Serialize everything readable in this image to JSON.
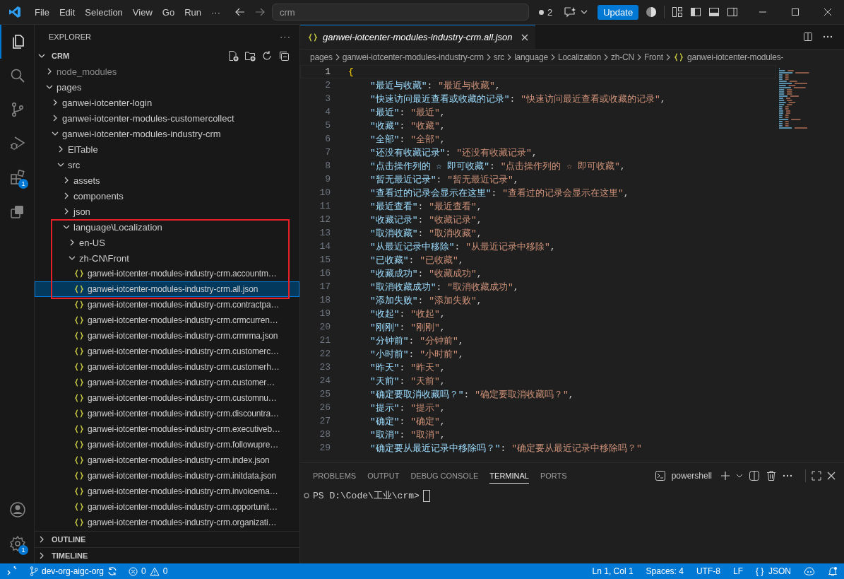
{
  "window": {
    "menu": [
      "File",
      "Edit",
      "Selection",
      "View",
      "Go",
      "Run",
      "···"
    ],
    "search": {
      "value": "crm"
    },
    "pending_count": "2",
    "update_button": "Update"
  },
  "activity_bar": {
    "items": [
      {
        "kind": "explorer",
        "selected": true
      },
      {
        "kind": "search",
        "selected": false
      },
      {
        "kind": "source-control",
        "selected": false
      },
      {
        "kind": "run-debug",
        "selected": false
      },
      {
        "kind": "extensions",
        "selected": false,
        "badge": "1"
      },
      {
        "kind": "remote",
        "selected": false
      }
    ],
    "bottom": [
      {
        "kind": "account"
      },
      {
        "kind": "settings",
        "badge": "1"
      }
    ]
  },
  "sidebar": {
    "title": "EXPLORER",
    "more": "···",
    "folder": "CRM",
    "tree": [
      {
        "kind": "folder",
        "label": "node_modules",
        "expanded": false,
        "ignored": true,
        "selected": false,
        "boxed": false
      },
      {
        "kind": "folder",
        "label": "pages",
        "expanded": true,
        "ignored": false,
        "selected": false,
        "boxed": false,
        "children": [
          {
            "kind": "folder",
            "label": "ganwei-iotcenter-login",
            "expanded": false,
            "ignored": false,
            "selected": false,
            "boxed": false
          },
          {
            "kind": "folder",
            "label": "ganwei-iotcenter-modules-customercollect",
            "expanded": false,
            "ignored": false,
            "selected": false,
            "boxed": false
          },
          {
            "kind": "folder",
            "label": "ganwei-iotcenter-modules-industry-crm",
            "expanded": true,
            "ignored": false,
            "selected": false,
            "boxed": false,
            "children": [
              {
                "kind": "folder",
                "label": "ElTable",
                "expanded": false,
                "ignored": false,
                "selected": false,
                "boxed": false
              },
              {
                "kind": "folder",
                "label": "src",
                "expanded": true,
                "ignored": false,
                "selected": false,
                "boxed": false,
                "children": [
                  {
                    "kind": "folder",
                    "label": "assets",
                    "expanded": false,
                    "ignored": false,
                    "selected": false,
                    "boxed": false
                  },
                  {
                    "kind": "folder",
                    "label": "components",
                    "expanded": false,
                    "ignored": false,
                    "selected": false,
                    "boxed": false
                  },
                  {
                    "kind": "folder",
                    "label": "json",
                    "expanded": false,
                    "ignored": false,
                    "selected": false,
                    "boxed": false
                  },
                  {
                    "kind": "folder",
                    "label": "language\\Localization",
                    "expanded": true,
                    "ignored": false,
                    "selected": false,
                    "boxed": true,
                    "children": [
                      {
                        "kind": "folder",
                        "label": "en-US",
                        "expanded": false,
                        "ignored": false,
                        "selected": false,
                        "boxed": true
                      },
                      {
                        "kind": "folder",
                        "label": "zh-CN\\Front",
                        "expanded": true,
                        "ignored": false,
                        "selected": false,
                        "boxed": true,
                        "children": [
                          {
                            "kind": "file",
                            "label": "ganwei-iotcenter-modules-industry-crm.accountm…",
                            "selected": false,
                            "boxed": true
                          },
                          {
                            "kind": "file",
                            "label": "ganwei-iotcenter-modules-industry-crm.all.json",
                            "selected": true,
                            "boxed": true
                          },
                          {
                            "kind": "file",
                            "label": "ganwei-iotcenter-modules-industry-crm.contractpa…",
                            "selected": false,
                            "boxed": false
                          },
                          {
                            "kind": "file",
                            "label": "ganwei-iotcenter-modules-industry-crm.crmcurren…",
                            "selected": false,
                            "boxed": false
                          },
                          {
                            "kind": "file",
                            "label": "ganwei-iotcenter-modules-industry-crm.crmrma.json",
                            "selected": false,
                            "boxed": false
                          },
                          {
                            "kind": "file",
                            "label": "ganwei-iotcenter-modules-industry-crm.customerc…",
                            "selected": false,
                            "boxed": false
                          },
                          {
                            "kind": "file",
                            "label": "ganwei-iotcenter-modules-industry-crm.customerh…",
                            "selected": false,
                            "boxed": false
                          },
                          {
                            "kind": "file",
                            "label": "ganwei-iotcenter-modules-industry-crm.customer…",
                            "selected": false,
                            "boxed": false
                          },
                          {
                            "kind": "file",
                            "label": "ganwei-iotcenter-modules-industry-crm.customnu…",
                            "selected": false,
                            "boxed": false
                          },
                          {
                            "kind": "file",
                            "label": "ganwei-iotcenter-modules-industry-crm.discountra…",
                            "selected": false,
                            "boxed": false
                          },
                          {
                            "kind": "file",
                            "label": "ganwei-iotcenter-modules-industry-crm.executiveb…",
                            "selected": false,
                            "boxed": false
                          },
                          {
                            "kind": "file",
                            "label": "ganwei-iotcenter-modules-industry-crm.followupre…",
                            "selected": false,
                            "boxed": false
                          },
                          {
                            "kind": "file",
                            "label": "ganwei-iotcenter-modules-industry-crm.index.json",
                            "selected": false,
                            "boxed": false
                          },
                          {
                            "kind": "file",
                            "label": "ganwei-iotcenter-modules-industry-crm.initdata.json",
                            "selected": false,
                            "boxed": false
                          },
                          {
                            "kind": "file",
                            "label": "ganwei-iotcenter-modules-industry-crm.invoicema…",
                            "selected": false,
                            "boxed": false
                          },
                          {
                            "kind": "file",
                            "label": "ganwei-iotcenter-modules-industry-crm.opportunit…",
                            "selected": false,
                            "boxed": false
                          },
                          {
                            "kind": "file",
                            "label": "ganwei-iotcenter-modules-industry-crm.organizati…",
                            "selected": false,
                            "boxed": false
                          }
                        ]
                      }
                    ]
                  }
                ]
              }
            ]
          }
        ]
      }
    ],
    "sections": [
      {
        "label": "OUTLINE",
        "expanded": false
      },
      {
        "label": "TIMELINE",
        "expanded": false
      }
    ]
  },
  "editor": {
    "tab": {
      "title": "ganwei-iotcenter-modules-industry-crm.all.json",
      "selected": true
    },
    "breadcrumbs": [
      "pages",
      "ganwei-iotcenter-modules-industry-crm",
      "src",
      "language",
      "Localization",
      "zh-CN",
      "Front",
      "ganwei-iotcenter-modules-"
    ],
    "lines": [
      {
        "n": "1",
        "current": true,
        "kind": "brace",
        "tokens": [
          "{"
        ]
      },
      {
        "n": "2",
        "current": false,
        "kind": "pair",
        "tokens": [
          "\"最近与收藏\"",
          ": ",
          "\"最近与收藏\"",
          ","
        ]
      },
      {
        "n": "3",
        "current": false,
        "kind": "pair",
        "tokens": [
          "\"快速访问最近查看或收藏的记录\"",
          ": ",
          "\"快速访问最近查看或收藏的记录\"",
          ","
        ]
      },
      {
        "n": "4",
        "current": false,
        "kind": "pair",
        "tokens": [
          "\"最近\"",
          ": ",
          "\"最近\"",
          ","
        ]
      },
      {
        "n": "5",
        "current": false,
        "kind": "pair",
        "tokens": [
          "\"收藏\"",
          ": ",
          "\"收藏\"",
          ","
        ]
      },
      {
        "n": "6",
        "current": false,
        "kind": "pair",
        "tokens": [
          "\"全部\"",
          ": ",
          "\"全部\"",
          ","
        ]
      },
      {
        "n": "7",
        "current": false,
        "kind": "pair",
        "tokens": [
          "\"还没有收藏记录\"",
          ": ",
          "\"还没有收藏记录\"",
          ","
        ]
      },
      {
        "n": "8",
        "current": false,
        "kind": "pair",
        "tokens": [
          "\"点击操作列的 ☆ 即可收藏\"",
          ": ",
          "\"点击操作列的 ☆ 即可收藏\"",
          ","
        ]
      },
      {
        "n": "9",
        "current": false,
        "kind": "pair",
        "tokens": [
          "\"暂无最近记录\"",
          ": ",
          "\"暂无最近记录\"",
          ","
        ]
      },
      {
        "n": "10",
        "current": false,
        "kind": "pair",
        "tokens": [
          "\"查看过的记录会显示在这里\"",
          ": ",
          "\"查看过的记录会显示在这里\"",
          ","
        ]
      },
      {
        "n": "11",
        "current": false,
        "kind": "pair",
        "tokens": [
          "\"最近查看\"",
          ": ",
          "\"最近查看\"",
          ","
        ]
      },
      {
        "n": "12",
        "current": false,
        "kind": "pair",
        "tokens": [
          "\"收藏记录\"",
          ": ",
          "\"收藏记录\"",
          ","
        ]
      },
      {
        "n": "13",
        "current": false,
        "kind": "pair",
        "tokens": [
          "\"取消收藏\"",
          ": ",
          "\"取消收藏\"",
          ","
        ]
      },
      {
        "n": "14",
        "current": false,
        "kind": "pair",
        "tokens": [
          "\"从最近记录中移除\"",
          ": ",
          "\"从最近记录中移除\"",
          ","
        ]
      },
      {
        "n": "15",
        "current": false,
        "kind": "pair",
        "tokens": [
          "\"已收藏\"",
          ": ",
          "\"已收藏\"",
          ","
        ]
      },
      {
        "n": "16",
        "current": false,
        "kind": "pair",
        "tokens": [
          "\"收藏成功\"",
          ": ",
          "\"收藏成功\"",
          ","
        ]
      },
      {
        "n": "17",
        "current": false,
        "kind": "pair",
        "tokens": [
          "\"取消收藏成功\"",
          ": ",
          "\"取消收藏成功\"",
          ","
        ]
      },
      {
        "n": "18",
        "current": false,
        "kind": "pair",
        "tokens": [
          "\"添加失败\"",
          ": ",
          "\"添加失败\"",
          ","
        ]
      },
      {
        "n": "19",
        "current": false,
        "kind": "pair",
        "tokens": [
          "\"收起\"",
          ": ",
          "\"收起\"",
          ","
        ]
      },
      {
        "n": "20",
        "current": false,
        "kind": "pair",
        "tokens": [
          "\"刚刚\"",
          ": ",
          "\"刚刚\"",
          ","
        ]
      },
      {
        "n": "21",
        "current": false,
        "kind": "pair",
        "tokens": [
          "\"分钟前\"",
          ": ",
          "\"分钟前\"",
          ","
        ]
      },
      {
        "n": "22",
        "current": false,
        "kind": "pair",
        "tokens": [
          "\"小时前\"",
          ": ",
          "\"小时前\"",
          ","
        ]
      },
      {
        "n": "23",
        "current": false,
        "kind": "pair",
        "tokens": [
          "\"昨天\"",
          ": ",
          "\"昨天\"",
          ","
        ]
      },
      {
        "n": "24",
        "current": false,
        "kind": "pair",
        "tokens": [
          "\"天前\"",
          ": ",
          "\"天前\"",
          ","
        ]
      },
      {
        "n": "25",
        "current": false,
        "kind": "pair",
        "tokens": [
          "\"确定要取消收藏吗？\"",
          ": ",
          "\"确定要取消收藏吗？\"",
          ","
        ]
      },
      {
        "n": "26",
        "current": false,
        "kind": "pair",
        "tokens": [
          "\"提示\"",
          ": ",
          "\"提示\"",
          ","
        ]
      },
      {
        "n": "27",
        "current": false,
        "kind": "pair",
        "tokens": [
          "\"确定\"",
          ": ",
          "\"确定\"",
          ","
        ]
      },
      {
        "n": "28",
        "current": false,
        "kind": "pair",
        "tokens": [
          "\"取消\"",
          ": ",
          "\"取消\"",
          ","
        ]
      },
      {
        "n": "29",
        "current": false,
        "kind": "pair",
        "tokens": [
          "\"确定要从最近记录中移除吗？\"",
          ": ",
          "\"确定要从最近记录中移除吗？\""
        ]
      }
    ]
  },
  "panel": {
    "tabs": [
      {
        "label": "PROBLEMS",
        "selected": false
      },
      {
        "label": "OUTPUT",
        "selected": false
      },
      {
        "label": "DEBUG CONSOLE",
        "selected": false
      },
      {
        "label": "TERMINAL",
        "selected": true
      },
      {
        "label": "PORTS",
        "selected": false
      }
    ],
    "shell": "powershell",
    "prompt": "PS D:\\Code\\工业\\crm>"
  },
  "status_bar": {
    "branch": "dev-org-aigc-org",
    "errors": "0",
    "warnings": "0",
    "position": "Ln 1, Col 1",
    "indent": "Spaces: 4",
    "encoding": "UTF-8",
    "eol": "LF",
    "language_icon": "{ }",
    "language": "JSON"
  }
}
